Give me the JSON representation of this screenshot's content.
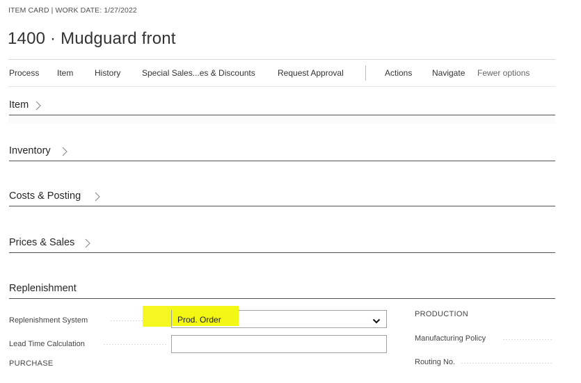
{
  "header": {
    "breadcrumb": "ITEM CARD | WORK DATE: 1/27/2022",
    "title": "1400 · Mudguard front"
  },
  "actions": [
    "Process",
    "Item",
    "History",
    "Special Sales...es & Discounts",
    "Request Approval",
    "Actions",
    "Navigate",
    "Fewer options"
  ],
  "sections": {
    "item": "Item",
    "inventory": "Inventory",
    "costs_posting": "Costs & Posting",
    "prices_sales": "Prices & Sales",
    "replenishment": "Replenishment"
  },
  "replenishment": {
    "replenishment_system_label": "Replenishment System",
    "replenishment_system_value": "Prod. Order",
    "lead_time_label": "Lead Time Calculation",
    "lead_time_value": "",
    "purchase_group": "PURCHASE",
    "production_group": "PRODUCTION",
    "manufacturing_policy_label": "Manufacturing Policy",
    "routing_no_label": "Routing No."
  },
  "colors": {
    "highlight": "#f3f714",
    "section_underline": "#505050"
  },
  "icons": {
    "section_chevron": "chevron-right-icon",
    "select_caret": "chevron-down-icon"
  }
}
